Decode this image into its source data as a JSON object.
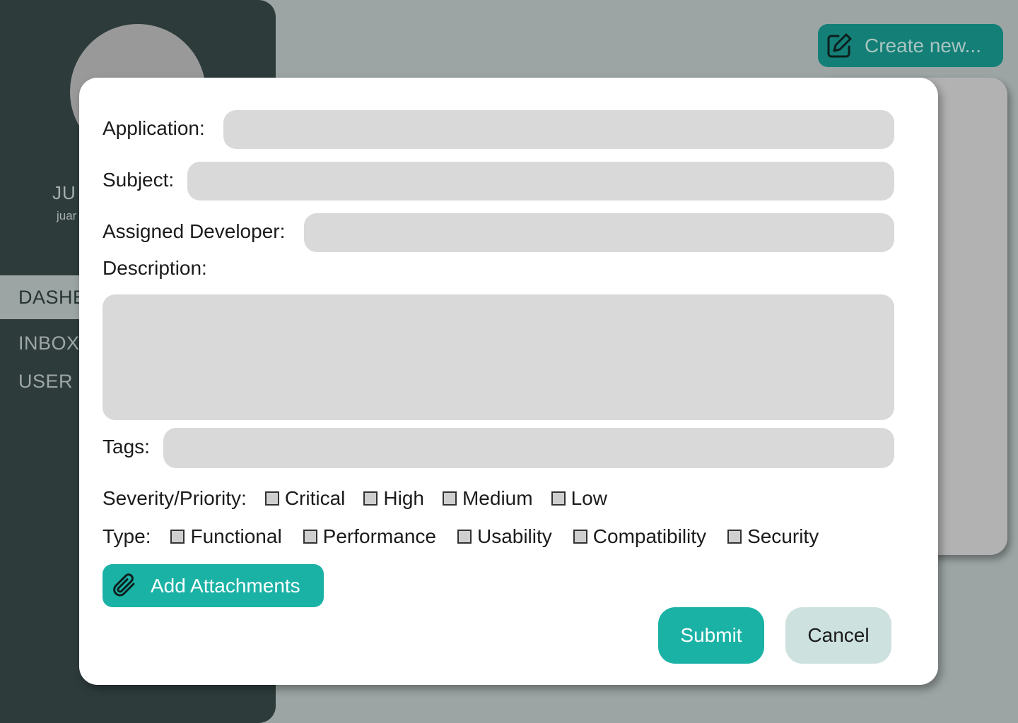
{
  "sidebar": {
    "user_name": "JU",
    "user_email": "juar",
    "nav": [
      {
        "label": "DASHB",
        "active": true
      },
      {
        "label": "INBOX",
        "active": false
      },
      {
        "label": "USER I",
        "active": false
      }
    ]
  },
  "header": {
    "create_label": "Create new...",
    "create_icon": "edit-icon"
  },
  "modal": {
    "application_label": "Application:",
    "application_value": "",
    "subject_label": "Subject:",
    "subject_value": "",
    "developer_label": "Assigned Developer:",
    "developer_value": "",
    "description_label": "Description:",
    "description_value": "",
    "tags_label": "Tags:",
    "tags_value": "",
    "severity_label": "Severity/Priority:",
    "severity_options": [
      "Critical",
      "High",
      "Medium",
      "Low"
    ],
    "type_label": "Type:",
    "type_options": [
      "Functional",
      "Performance",
      "Usability",
      "Compatibility",
      "Security"
    ],
    "attach_label": "Add Attachments",
    "attach_icon": "paperclip-icon",
    "submit_label": "Submit",
    "cancel_label": "Cancel"
  },
  "colors": {
    "accent": "#1bb2a6",
    "accent_dark": "#137f77",
    "sidebar": "#2d3c3b",
    "background": "#9ca5a4",
    "field": "#d9d9d9",
    "cancel": "#cde2df"
  }
}
